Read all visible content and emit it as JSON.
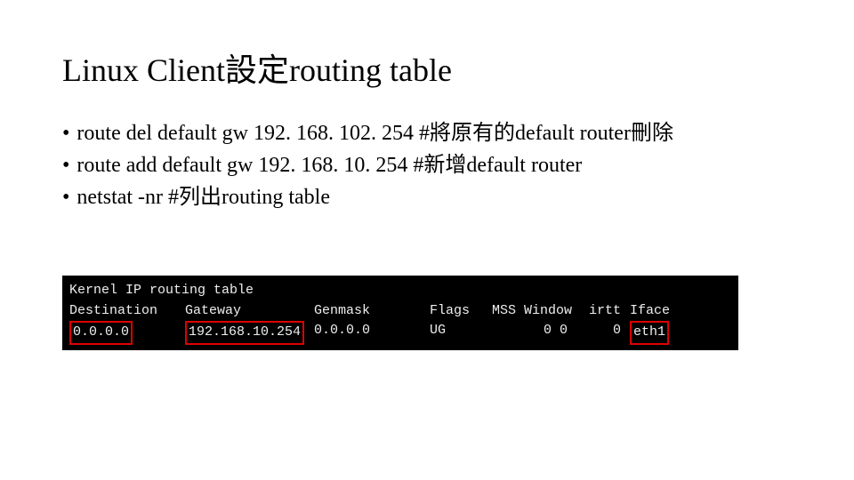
{
  "title": "Linux Client設定routing table",
  "bullets": {
    "b1": "route del default gw 192. 168. 102. 254  #將原有的default router刪除",
    "b2": "route add default gw 192. 168. 10. 254  #新增default router",
    "b3": "netstat -nr  #列出routing table"
  },
  "terminal": {
    "caption": "Kernel IP routing table",
    "headers": {
      "dest": "Destination",
      "gw": "Gateway",
      "mask": "Genmask",
      "flags": "Flags",
      "mss": "MSS Window",
      "irtt": "irtt",
      "iface": "Iface"
    },
    "row": {
      "dest": "0.0.0.0",
      "gw": "192.168.10.254",
      "mask": "0.0.0.0",
      "flags": "UG",
      "mss": "0 0",
      "irtt": "0",
      "iface": "eth1"
    }
  }
}
